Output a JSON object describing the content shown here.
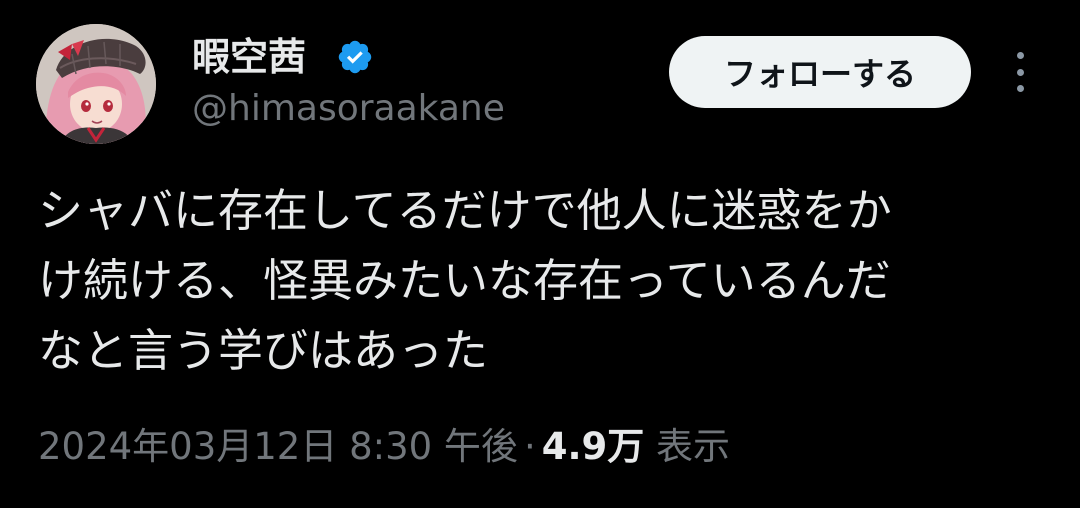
{
  "tweet": {
    "author": {
      "display_name": "暇空茜",
      "handle": "@himasoraakane",
      "verified": true,
      "verified_color": "#1d9bf0"
    },
    "follow_label": "フォローする",
    "more_icon": "more-vertical-icon",
    "text_lines": [
      "シャバに存在してるだけで他人に迷惑をか",
      "け続ける、怪異みたいな存在っているんだ",
      "なと言う学びはあった"
    ],
    "timestamp": "2024年03月12日 8:30 午後",
    "separator": "·",
    "views_count": "4.9万",
    "views_label": "表示"
  },
  "colors": {
    "background": "#000000",
    "primary_text": "#e7e9ea",
    "secondary_text": "#71767b",
    "follow_button_bg": "#eff3f4",
    "follow_button_text": "#0f1419"
  }
}
